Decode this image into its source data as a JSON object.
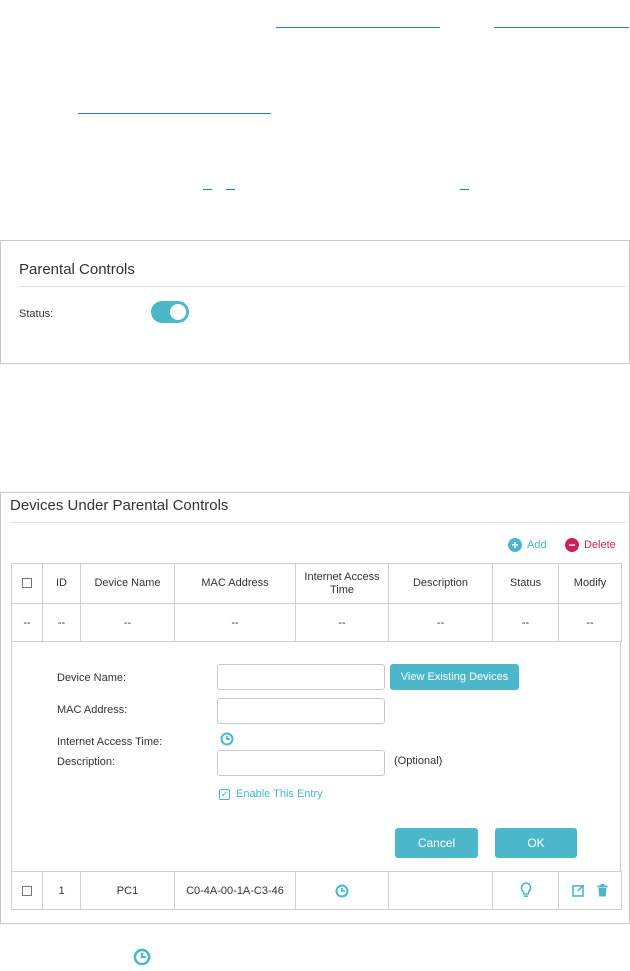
{
  "panel1": {
    "title": "Parental Controls",
    "status_label": "Status:",
    "status_on": true
  },
  "panel2": {
    "title": "Devices Under Parental Controls",
    "add_label": "Add",
    "delete_label": "Delete",
    "columns": [
      "ID",
      "Device Name",
      "MAC Address",
      "Internet Access Time",
      "Description",
      "Status",
      "Modify"
    ],
    "empty_row": [
      "--",
      "--",
      "--",
      "--",
      "--",
      "--",
      "--",
      "--"
    ],
    "form": {
      "device_name_label": "Device Name:",
      "mac_label": "MAC Address:",
      "time_label": "Internet Access Time:",
      "description_label": "Description:",
      "view_devices_button": "View Existing Devices",
      "optional_note": "(Optional)",
      "enable_label": "Enable This Entry",
      "enable_checked": true,
      "cancel_button": "Cancel",
      "ok_button": "OK"
    },
    "rows": [
      {
        "id": "1",
        "device_name": "PC1",
        "mac": "C0-4A-00-1A-C3-46",
        "description": ""
      }
    ]
  },
  "colors": {
    "accent": "#4bb7c8",
    "delete": "#c8225a",
    "link": "#2b7fa6"
  }
}
